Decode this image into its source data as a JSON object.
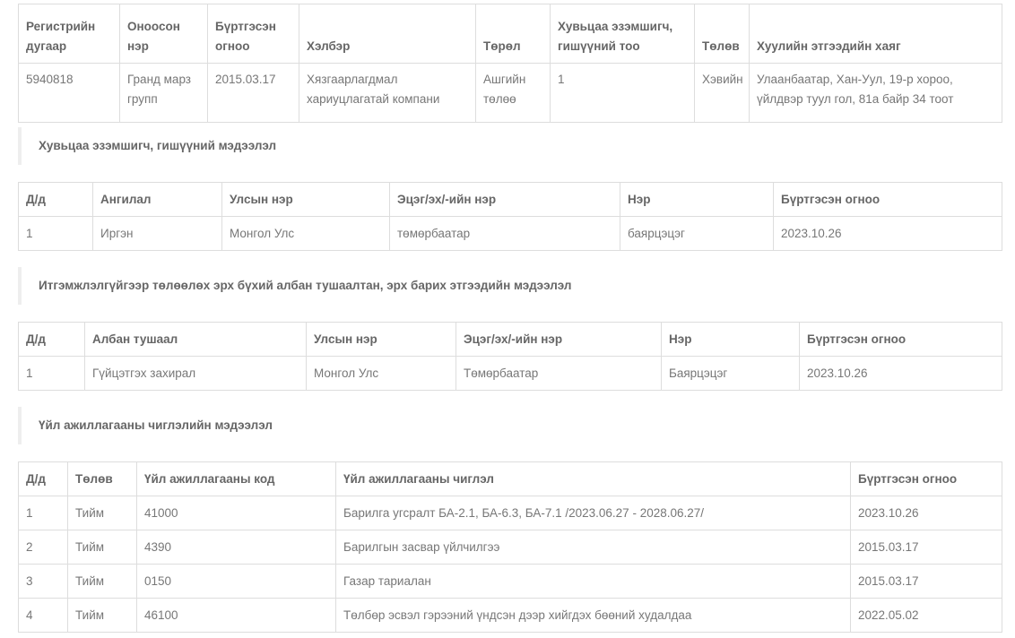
{
  "company_table": {
    "headers": [
      "Регистрийн дугаар",
      "Оноосон нэр",
      "Бүртгэсэн огноо",
      "Хэлбэр",
      "Төрөл",
      "Хувьцаа эзэмшигч, гишүүний тоо",
      "Төлөв",
      "Хуулийн этгээдийн хаяг"
    ],
    "row": [
      "5940818",
      "Гранд марз групп",
      "2015.03.17",
      "Хязгаарлагдмал хариуцлагатай компани",
      "Ашгийн төлөө",
      "1",
      "Хэвийн",
      "Улаанбаатар, Хан-Уул, 19-р хороо, үйлдвэр туул гол, 81а байр 34 тоот"
    ]
  },
  "shareholders": {
    "section_title": "Хувьцаа эзэмшигч, гишүүний мэдээлэл",
    "headers": [
      "Д/д",
      "Ангилал",
      "Улсын нэр",
      "Эцэг/эх/-ийн нэр",
      "Нэр",
      "Бүртгэсэн огноо"
    ],
    "rows": [
      [
        "1",
        "Иргэн",
        "Монгол Улс",
        "төмөрбаатар",
        "баярцэцэг",
        "2023.10.26"
      ]
    ]
  },
  "officials": {
    "section_title": "Итгэмжлэлгүйгээр төлөөлөх эрх бүхий албан тушаалтан, эрх барих этгээдийн мэдээлэл",
    "headers": [
      "Д/д",
      "Албан тушаал",
      "Улсын нэр",
      "Эцэг/эх/-ийн нэр",
      "Нэр",
      "Бүртгэсэн огноо"
    ],
    "rows": [
      [
        "1",
        "Гүйцэтгэх захирал",
        "Монгол Улс",
        "Төмөрбаатар",
        "Баярцэцэг",
        "2023.10.26"
      ]
    ]
  },
  "activities": {
    "section_title": "Үйл ажиллагааны чиглэлийн мэдээлэл",
    "headers": [
      "Д/д",
      "Төлөв",
      "Үйл ажиллагааны код",
      "Үйл ажиллагааны чиглэл",
      "Бүртгэсэн огноо"
    ],
    "rows": [
      [
        "1",
        "Тийм",
        "41000",
        "Барилга угсралт БА-2.1, БА-6.3, БА-7.1 /2023.06.27 - 2028.06.27/",
        "2023.10.26"
      ],
      [
        "2",
        "Тийм",
        "4390",
        "Барилгын засвар үйлчилгээ",
        "2015.03.17"
      ],
      [
        "3",
        "Тийм",
        "0150",
        "Газар тариалан",
        "2015.03.17"
      ],
      [
        "4",
        "Тийм",
        "46100",
        "Төлбөр эсвэл гэрээний үндсэн дээр хийгдэх бөөний худалдаа",
        "2022.05.02"
      ]
    ]
  }
}
